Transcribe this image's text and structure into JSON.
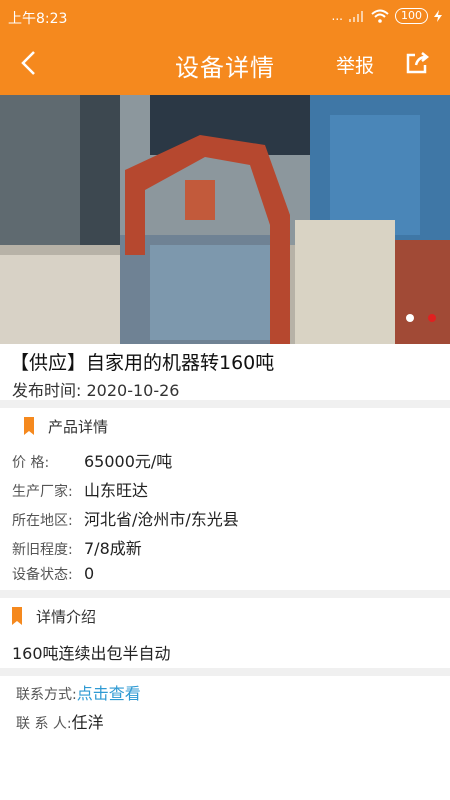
{
  "status": {
    "time": "上午8:23",
    "dots": "...",
    "battery": "100"
  },
  "nav": {
    "title": "设备详情",
    "report": "举报"
  },
  "carousel": {
    "image_desc": "baler machine",
    "active_index": 1,
    "count": 2
  },
  "product": {
    "title": "【供应】自家用的机器转160吨",
    "date_label": "发布时间:",
    "date": "2020-10-26"
  },
  "details": {
    "section_title": "产品详情",
    "rows": [
      {
        "label": "价    格:",
        "value": "65000元/吨"
      },
      {
        "label": "生产厂家:",
        "value": "山东旺达"
      },
      {
        "label": "所在地区:",
        "value": "河北省/沧州市/东光县"
      },
      {
        "label": "新旧程度:",
        "value": "7/8成新"
      },
      {
        "label": "设备状态:",
        "value": "0"
      }
    ]
  },
  "intro": {
    "section_title": "详情介绍",
    "text": "160吨连续出包半自动"
  },
  "contact": {
    "method_label": "联系方式:",
    "method_link": "点击查看",
    "person_label": "联 系 人:",
    "person": "任洋"
  },
  "colors": {
    "brand": "#f5891e",
    "link": "#2f9ad3",
    "active_dot": "#e02020"
  }
}
